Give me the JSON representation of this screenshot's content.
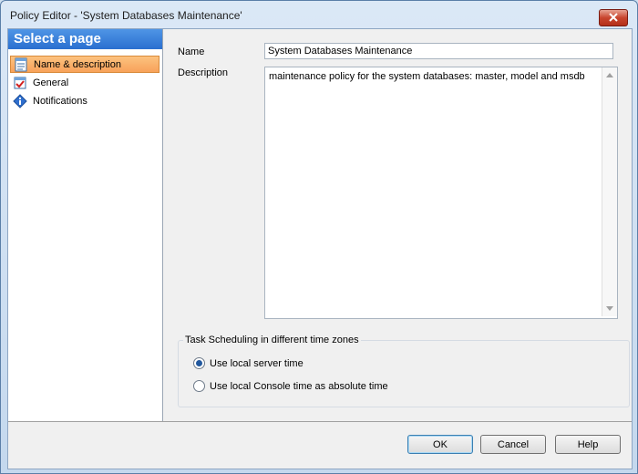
{
  "window": {
    "title": "Policy Editor - 'System Databases Maintenance'"
  },
  "sidebar": {
    "header": "Select a page",
    "items": [
      {
        "label": "Name & description",
        "icon": "document-icon"
      },
      {
        "label": "General",
        "icon": "checklist-icon"
      },
      {
        "label": "Notifications",
        "icon": "info-icon"
      }
    ]
  },
  "form": {
    "name_label": "Name",
    "name_value": "System Databases Maintenance",
    "description_label": "Description",
    "description_value": "maintenance policy for the system databases: master, model and msdb"
  },
  "scheduling": {
    "group_title": "Task Scheduling in different time zones",
    "option_local_server": "Use local server time",
    "option_console": "Use local Console time as absolute time",
    "selected": "option_local_server"
  },
  "buttons": {
    "ok": "OK",
    "cancel": "Cancel",
    "help": "Help"
  },
  "colors": {
    "sidebar_header": "#2a6fd0",
    "selected_item": "#f8a25a",
    "close_button": "#c8452e"
  }
}
